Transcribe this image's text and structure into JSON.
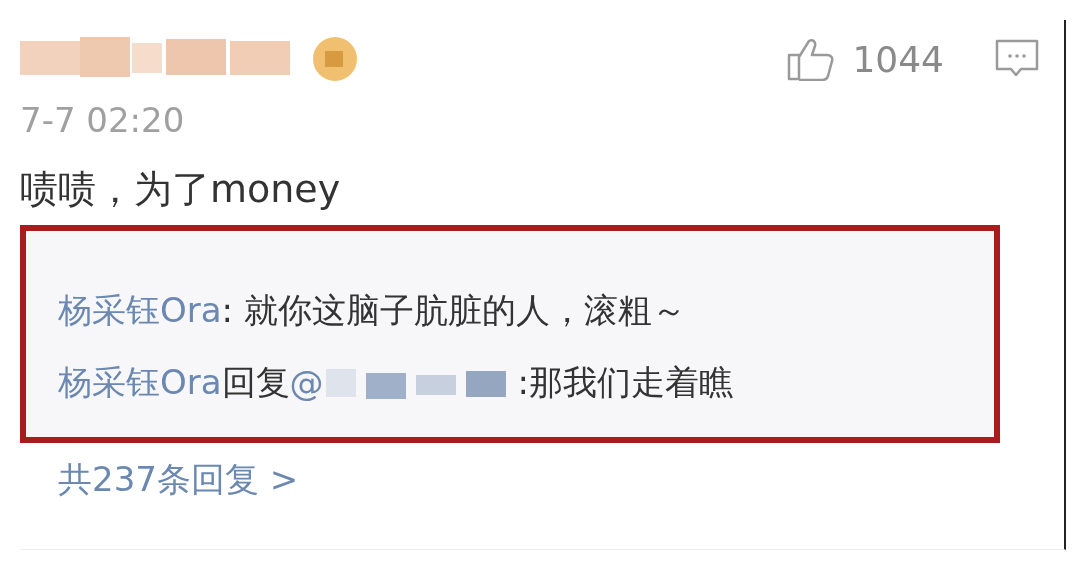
{
  "comment": {
    "like_count": "1044",
    "timestamp": "7-7 02:20",
    "text": "啧啧，为了money",
    "highlighted": true,
    "replies": [
      {
        "kind": "plain",
        "author": "杨采钰Ora",
        "text": ": 就你这脑子肮脏的人，滚粗～"
      },
      {
        "kind": "reply",
        "author": "杨采钰Ora",
        "action": "回复",
        "mention": "@",
        "text": ":那我们走着瞧"
      }
    ],
    "reply_count_link": "共237条回复 >"
  }
}
